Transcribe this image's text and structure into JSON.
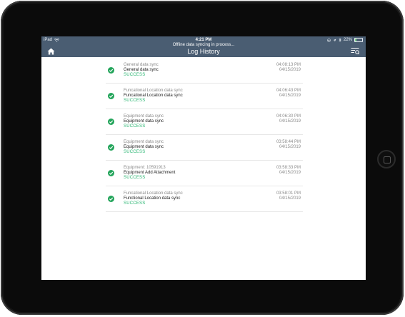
{
  "status_bar": {
    "carrier": "iPad",
    "time": "4:21 PM",
    "battery": "22%",
    "battery_level": 0.22
  },
  "header": {
    "sync_message": "Offline data syncing in process...",
    "title": "Log History",
    "home_icon": "home-icon",
    "filter_icon": "filter-list-icon",
    "bar_color": "#4a5d72"
  },
  "colors": {
    "success": "#2bb673",
    "check_icon": "#22a45a"
  },
  "logs": [
    {
      "line1": "General data sync",
      "line2": "General data sync",
      "status": "SUCCESS",
      "time": "04:08:13 PM",
      "date": "04/15/2019"
    },
    {
      "line1": "Funcational Location data sync",
      "line2": "Funcational Location data sync",
      "status": "SUCCESS",
      "time": "04:06:43 PM",
      "date": "04/15/2019"
    },
    {
      "line1": "Equipment data sync",
      "line2": "Equipment data sync",
      "status": "SUCCESS",
      "time": "04:06:30 PM",
      "date": "04/15/2019"
    },
    {
      "line1": "Equipment data sync",
      "line2": "Equipment data sync",
      "status": "SUCCESS",
      "time": "03:58:44 PM",
      "date": "04/15/2019"
    },
    {
      "line1": "Equipment: 10591913",
      "line2": "Equipment Add Attachment",
      "status": "SUCCESS",
      "time": "03:58:33 PM",
      "date": "04/15/2019"
    },
    {
      "line1": "Funcational Location data sync",
      "line2": "Functional Location data sync",
      "status": "SUCCESS",
      "time": "03:58:01 PM",
      "date": "04/15/2019"
    }
  ]
}
